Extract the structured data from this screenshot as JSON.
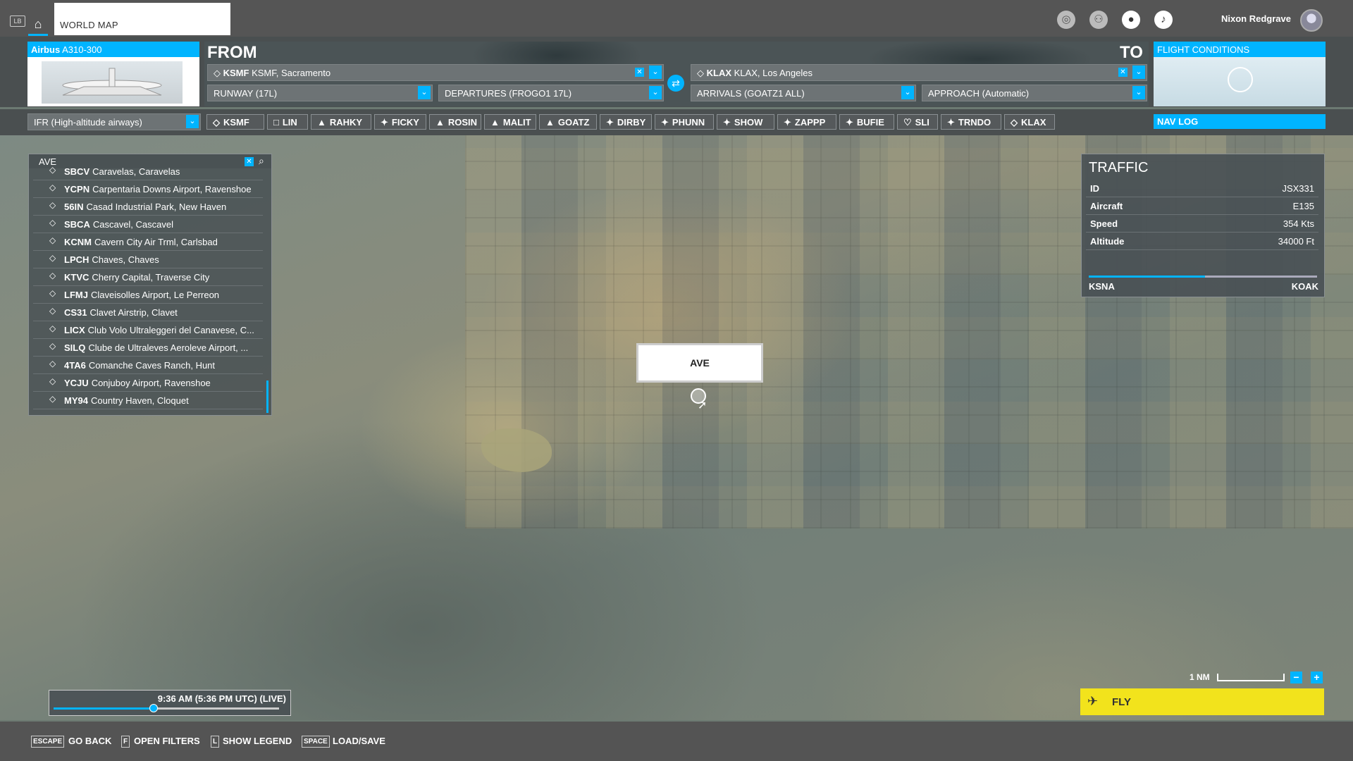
{
  "topbar": {
    "lb_tag": "LB",
    "tab_title": "WORLD MAP",
    "username": "Nixon Redgrave"
  },
  "flight_plan": {
    "aircraft_brand": "Airbus",
    "aircraft_model": "A310-300",
    "from_label": "FROM",
    "to_label": "TO",
    "from_code": "KSMF",
    "from_name": "KSMF, Sacramento",
    "to_code": "KLAX",
    "to_name": "KLAX, Los Angeles",
    "runway": "RUNWAY (17L)",
    "departure": "DEPARTURES (FROGO1 17L)",
    "arrival": "ARRIVALS (GOATZ1 ALL)",
    "approach": "APPROACH (Automatic)",
    "conditions_label": "FLIGHT CONDITIONS"
  },
  "route": {
    "flight_type": "IFR (High-altitude airways)",
    "waypoints": [
      {
        "icon": "◇",
        "name": "KSMF"
      },
      {
        "icon": "□",
        "name": "LIN"
      },
      {
        "icon": "▲",
        "name": "RAHKY"
      },
      {
        "icon": "✦",
        "name": "FICKY"
      },
      {
        "icon": "▲",
        "name": "ROSIN"
      },
      {
        "icon": "▲",
        "name": "MALIT"
      },
      {
        "icon": "▲",
        "name": "GOATZ"
      },
      {
        "icon": "✦",
        "name": "DIRBY"
      },
      {
        "icon": "✦",
        "name": "PHUNN"
      },
      {
        "icon": "✦",
        "name": "SHOW"
      },
      {
        "icon": "✦",
        "name": "ZAPPP"
      },
      {
        "icon": "✦",
        "name": "BUFIE"
      },
      {
        "icon": "♡",
        "name": "SLI"
      },
      {
        "icon": "✦",
        "name": "TRNDO"
      },
      {
        "icon": "◇",
        "name": "KLAX"
      }
    ],
    "navlog_label": "NAV LOG"
  },
  "search": {
    "query": "AVE",
    "results": [
      {
        "code": "SBCV",
        "name": "Caravelas, Caravelas"
      },
      {
        "code": "YCPN",
        "name": "Carpentaria Downs Airport, Ravenshoe"
      },
      {
        "code": "56IN",
        "name": "Casad Industrial Park, New Haven"
      },
      {
        "code": "SBCA",
        "name": "Cascavel, Cascavel"
      },
      {
        "code": "KCNM",
        "name": "Cavern City Air Trml, Carlsbad"
      },
      {
        "code": "LPCH",
        "name": "Chaves, Chaves"
      },
      {
        "code": "KTVC",
        "name": "Cherry Capital, Traverse City"
      },
      {
        "code": "LFMJ",
        "name": "Claveisolles Airport, Le Perreon"
      },
      {
        "code": "CS31",
        "name": "Clavet Airstrip, Clavet"
      },
      {
        "code": "LICX",
        "name": "Club Volo Ultraleggeri del Canavese, C..."
      },
      {
        "code": "SILQ",
        "name": "Clube de Ultraleves Aeroleve Airport, ..."
      },
      {
        "code": "4TA6",
        "name": "Comanche Caves Ranch, Hunt"
      },
      {
        "code": "YCJU",
        "name": "Conjuboy Airport, Ravenshoe"
      },
      {
        "code": "MY94",
        "name": "Country Haven, Cloquet"
      }
    ]
  },
  "map": {
    "label": "AVE"
  },
  "traffic": {
    "title": "TRAFFIC",
    "rows": [
      {
        "key": "ID",
        "value": "JSX331"
      },
      {
        "key": "Aircraft",
        "value": "E135"
      },
      {
        "key": "Speed",
        "value": "354 Kts"
      },
      {
        "key": "Altitude",
        "value": "34000 Ft"
      }
    ],
    "route_from": "KSNA",
    "route_to": "KOAK",
    "progress": 0.51
  },
  "time": {
    "label": "9:36 AM (5:36 PM UTC) (LIVE)",
    "slider_fraction": 0.44
  },
  "scale": {
    "label": "1 NM"
  },
  "fly": {
    "label": "FLY"
  },
  "footer": {
    "actions": [
      {
        "key": "ESCAPE",
        "label": "GO BACK"
      },
      {
        "key": "F",
        "label": "OPEN FILTERS"
      },
      {
        "key": "L",
        "label": "SHOW LEGEND"
      },
      {
        "key": "SPACE",
        "label": "LOAD/SAVE"
      }
    ]
  },
  "colors": {
    "accent": "#00b4ff",
    "fly": "#f2e31c"
  }
}
